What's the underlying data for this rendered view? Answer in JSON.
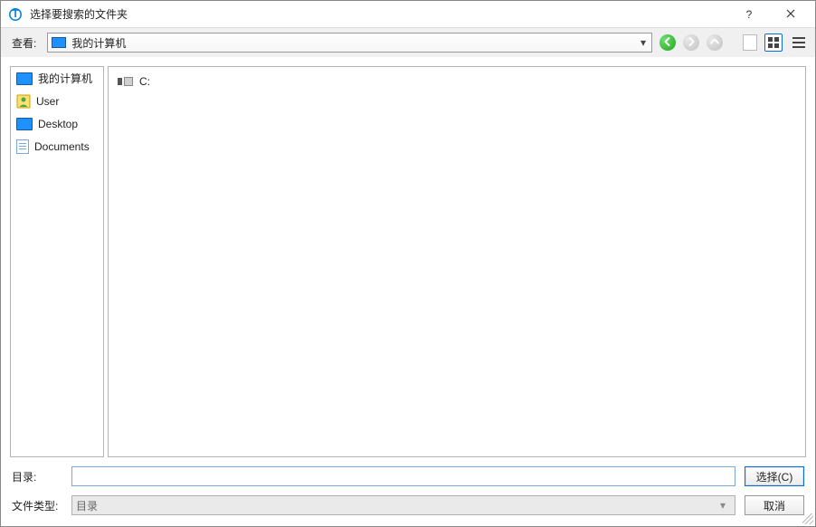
{
  "window": {
    "title": "选择要搜索的文件夹"
  },
  "toolbar": {
    "look_in_label": "查看:",
    "look_in_value": "我的计算机"
  },
  "sidebar": {
    "items": [
      {
        "icon": "computer",
        "label": "我的计算机"
      },
      {
        "icon": "user",
        "label": "User"
      },
      {
        "icon": "desktop",
        "label": "Desktop"
      },
      {
        "icon": "documents",
        "label": "Documents"
      }
    ]
  },
  "file_view": {
    "items": [
      {
        "icon": "drive",
        "label": "C:"
      }
    ]
  },
  "bottom": {
    "directory_label": "目录:",
    "directory_value": "",
    "filetype_label": "文件类型:",
    "filetype_value": "目录",
    "choose_label": "选择(C)",
    "cancel_label": "取消"
  }
}
